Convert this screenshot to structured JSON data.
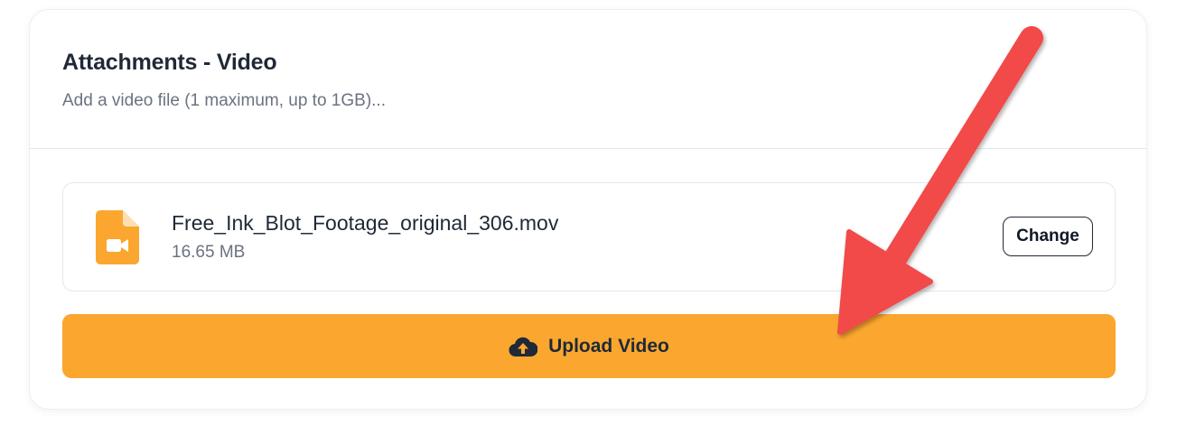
{
  "header": {
    "title": "Attachments - Video",
    "subtitle": "Add a video file (1 maximum, up to 1GB)..."
  },
  "file": {
    "name": "Free_Ink_Blot_Footage_original_306.mov",
    "size": "16.65 MB",
    "icon": "video-file-icon",
    "change_label": "Change"
  },
  "upload": {
    "label": "Upload Video",
    "icon": "cloud-upload-icon"
  },
  "colors": {
    "accent": "#fba72f",
    "annotation_arrow": "#f24848"
  }
}
